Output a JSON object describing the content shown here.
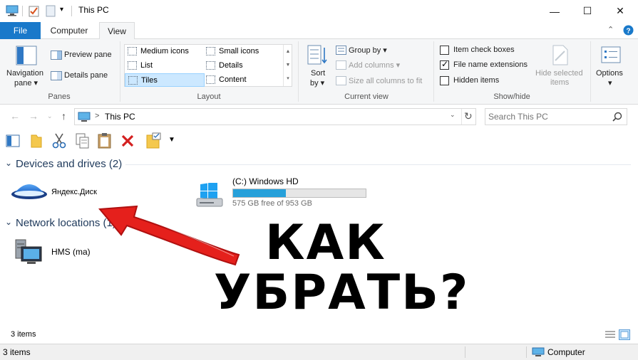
{
  "window": {
    "title": "This PC",
    "controls": {
      "minimize": "—",
      "maximize": "☐",
      "close": "✕"
    }
  },
  "tabs": [
    {
      "label": "File"
    },
    {
      "label": "Computer"
    },
    {
      "label": "View"
    }
  ],
  "ribbon": {
    "panes": {
      "navigation_pane": "Navigation",
      "navigation_pane_2": "pane ▾",
      "preview_pane": "Preview pane",
      "details_pane": "Details pane",
      "group_label": "Panes"
    },
    "layout": {
      "items": [
        "Medium icons",
        "Small icons",
        "List",
        "Details",
        "Tiles",
        "Content"
      ],
      "selected": "Tiles",
      "group_label": "Layout"
    },
    "current_view": {
      "sort_by": "Sort",
      "sort_by_2": "by ▾",
      "group_by": "Group by ▾",
      "add_columns": "Add columns ▾",
      "size_all_columns": "Size all columns to fit",
      "group_label": "Current view"
    },
    "show_hide": {
      "item_check_boxes": "Item check boxes",
      "file_name_extensions": "File name extensions",
      "hidden_items": "Hidden items",
      "hide_selected_items": "Hide selected",
      "hide_selected_items_2": "items",
      "group_label": "Show/hide",
      "checked": {
        "item_check_boxes": false,
        "file_name_extensions": true,
        "hidden_items": false
      }
    },
    "options": {
      "label": "Options",
      "chevron": "▾"
    }
  },
  "address": {
    "path": "This PC",
    "separator": ">"
  },
  "search": {
    "placeholder": "Search This PC"
  },
  "sections": {
    "devices": {
      "label": "Devices and drives (2)"
    },
    "network": {
      "label": "Network locations (1)"
    }
  },
  "drives": [
    {
      "name": "Яндекс.Диск"
    },
    {
      "name": "(C:) Windows HD",
      "free_text": "575 GB free of 953 GB",
      "used_fraction": 0.397
    }
  ],
  "network_items": [
    {
      "name": "HMS (ma)"
    }
  ],
  "overlay": {
    "line1": "КАК",
    "line2": "УБРАТЬ?"
  },
  "status": {
    "count_top": "3 items",
    "count_bottom": "3 items",
    "location": "Computer"
  },
  "colors": {
    "accent": "#1979ca",
    "drive_bar": "#26a0da",
    "arrow": "#e5201c"
  }
}
